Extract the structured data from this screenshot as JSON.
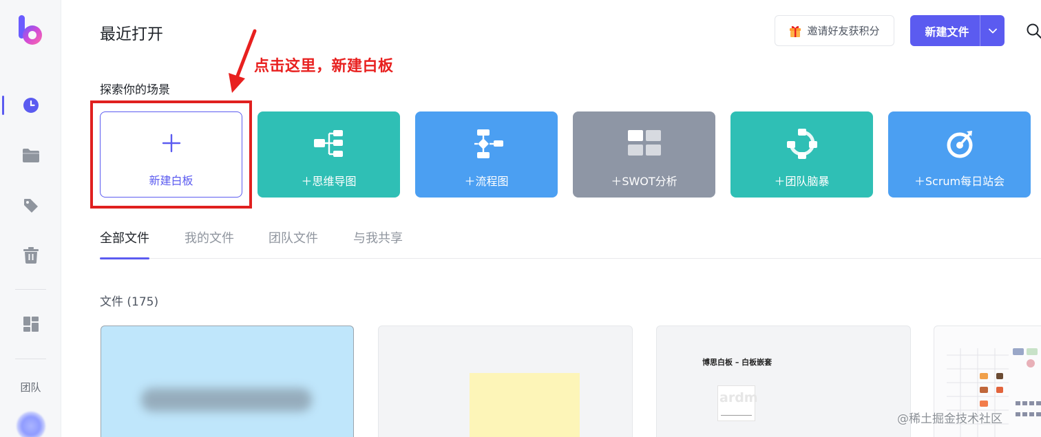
{
  "header": {
    "title": "最近打开",
    "invite_label": "邀请好友获积分",
    "new_file_label": "新建文件"
  },
  "annotation": {
    "text": "点击这里，新建白板",
    "color": "#e8201f"
  },
  "sidebar": {
    "items": [
      {
        "name": "recent",
        "icon": "clock-icon",
        "active": true
      },
      {
        "name": "folder",
        "icon": "folder-icon",
        "active": false
      },
      {
        "name": "tags",
        "icon": "tag-icon",
        "active": false
      },
      {
        "name": "trash",
        "icon": "trash-icon",
        "active": false
      },
      {
        "name": "templates",
        "icon": "grid-icon",
        "active": false
      }
    ],
    "team_label": "团队"
  },
  "scenes": {
    "label": "探索你的场景",
    "new_board": {
      "label": "新建白板",
      "icon": "plus-icon"
    },
    "items": [
      {
        "label": "＋思维导图",
        "color": "#2fbfb5",
        "icon": "mindmap-icon"
      },
      {
        "label": "＋流程图",
        "color": "#4b9ff2",
        "icon": "flowchart-icon"
      },
      {
        "label": "＋SWOT分析",
        "color": "#8e96a5",
        "icon": "swot-icon"
      },
      {
        "label": "＋团队脑暴",
        "color": "#2fbfb5",
        "icon": "brainstorm-icon"
      },
      {
        "label": "＋Scrum每日站会",
        "color": "#4b9ff2",
        "icon": "scrum-icon"
      }
    ]
  },
  "tabs": [
    {
      "label": "全部文件",
      "active": true
    },
    {
      "label": "我的文件",
      "active": false
    },
    {
      "label": "团队文件",
      "active": false
    },
    {
      "label": "与我共享",
      "active": false
    }
  ],
  "files": {
    "count_label": "文件 (175)",
    "thumb3_title": "博思白板 – 白板嵌套",
    "thumb3_card_text": "ardm"
  },
  "watermark": "@稀土掘金技术社区",
  "colors": {
    "accent": "#5b5bf0",
    "annotation_red": "#e8201f"
  }
}
